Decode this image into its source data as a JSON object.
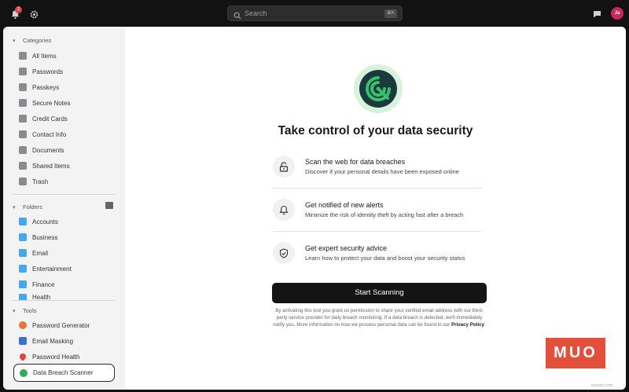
{
  "topbar": {
    "notification_count": "2",
    "search_placeholder": "Search",
    "search_shortcut": "⌘K",
    "avatar_initials": "Ja"
  },
  "sidebar": {
    "categories_label": "Categories",
    "categories": [
      {
        "label": "All Items",
        "icon": "layers-icon"
      },
      {
        "label": "Passwords",
        "icon": "key-icon"
      },
      {
        "label": "Passkeys",
        "icon": "passkey-icon"
      },
      {
        "label": "Secure Notes",
        "icon": "note-icon"
      },
      {
        "label": "Credit Cards",
        "icon": "credit-card-icon"
      },
      {
        "label": "Contact Info",
        "icon": "contact-icon"
      },
      {
        "label": "Documents",
        "icon": "document-icon"
      },
      {
        "label": "Shared Items",
        "icon": "people-icon"
      },
      {
        "label": "Trash",
        "icon": "trash-icon"
      }
    ],
    "folders_label": "Folders",
    "folders": [
      {
        "label": "Accounts"
      },
      {
        "label": "Business"
      },
      {
        "label": "Email"
      },
      {
        "label": "Entertainment"
      },
      {
        "label": "Finance"
      },
      {
        "label": "Health"
      }
    ],
    "tools_label": "Tools",
    "tools": [
      {
        "label": "Password Generator",
        "icon": "password-generator-icon",
        "color": "#e8743b"
      },
      {
        "label": "Email Masking",
        "icon": "email-mask-icon",
        "color": "#3b6fd1"
      },
      {
        "label": "Password Health",
        "icon": "heart-icon",
        "color": "#e0443c"
      },
      {
        "label": "Data Breach Scanner",
        "icon": "scanner-icon",
        "color": "#2fae55"
      }
    ]
  },
  "main": {
    "title": "Take control of your data security",
    "features": [
      {
        "heading": "Scan the web for data breaches",
        "desc": "Discover if your personal details have been exposed online",
        "icon": "unlock-icon"
      },
      {
        "heading": "Get notified of new alerts",
        "desc": "Minimize the risk of identity theft by acting fast after a breach",
        "icon": "bell-icon"
      },
      {
        "heading": "Get expert security advice",
        "desc": "Learn how to protect your data and boost your security status",
        "icon": "shield-check-icon"
      }
    ],
    "cta": "Start Scanning",
    "disclaimer": "By activating this tool you grant us permission to share your verified email address with our third-party service provider for daily breach monitoring. If a data breach is detected, we'll immediately notify you. More information on how we process personal data can be found in our",
    "privacy_link": "Privacy Policy",
    "privacy_suffix": "."
  },
  "watermark": {
    "brand": "MUO",
    "site": "wsxdn.com"
  },
  "colors": {
    "accent_green": "#2fae55",
    "folder_blue": "#44a7ef",
    "button_dark": "#141414"
  }
}
